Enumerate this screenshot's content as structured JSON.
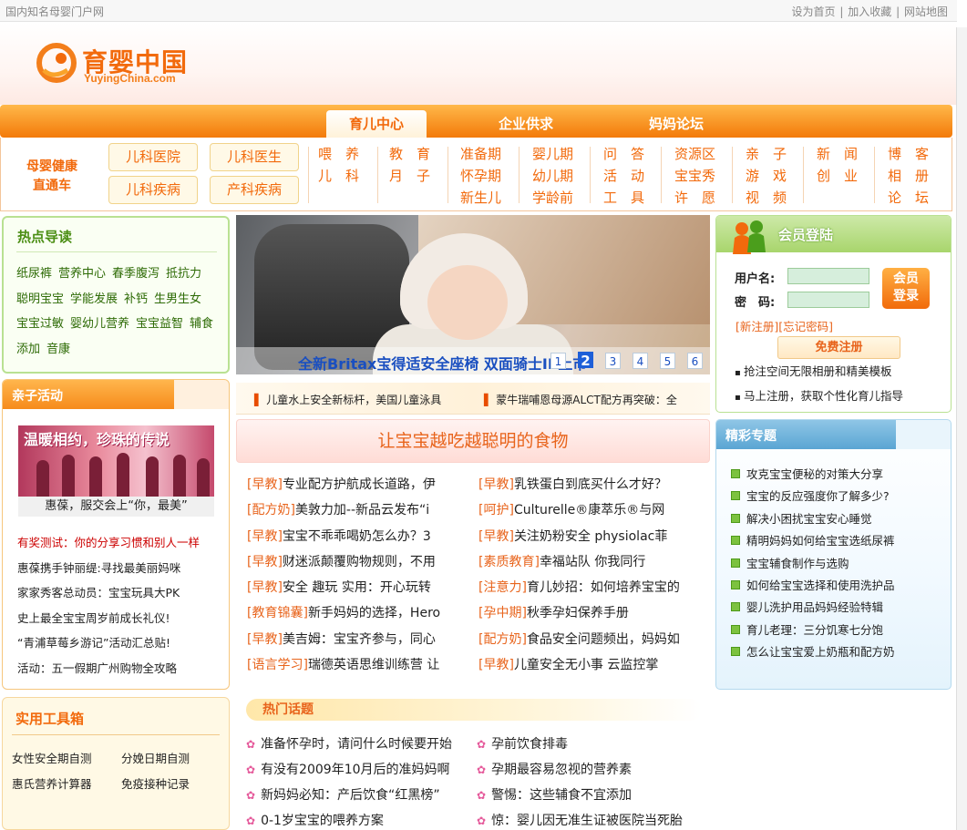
{
  "topbar": {
    "left_text": "国内知名母婴门户网",
    "links": [
      "设为首页",
      "加入收藏",
      "网站地图"
    ],
    "separator": "|"
  },
  "logo": {
    "name": "育婴中国",
    "sub": "YuyingChina.com"
  },
  "nav": {
    "tabs": [
      "育儿中心",
      "企业供求",
      "妈妈论坛"
    ]
  },
  "subnav": {
    "direct": [
      "母婴健康",
      "直通车"
    ],
    "buttons": [
      "儿科医院",
      "儿科医生",
      "儿科疾病",
      "产科疾病"
    ],
    "cols": [
      [
        "喂　养",
        "儿　科"
      ],
      [
        "教　育",
        "月　子"
      ],
      [
        "准备期",
        "怀孕期",
        "新生儿"
      ],
      [
        "婴儿期",
        "幼儿期",
        "学龄前"
      ],
      [
        "问　答",
        "活　动",
        "工　具"
      ],
      [
        "资源区",
        "宝宝秀",
        "许　愿"
      ],
      [
        "亲　子",
        "游　戏",
        "视　频"
      ],
      [
        "新　闻",
        "创　业"
      ],
      [
        "博　客",
        "相　册",
        "论　坛"
      ]
    ]
  },
  "hot": {
    "title": "热点导读",
    "tags": [
      "纸尿裤",
      "营养中心",
      "春季腹泻",
      "抵抗力",
      "聪明宝宝",
      "学能发展",
      "补钙",
      "生男生女",
      "宝宝过敏",
      "婴幼儿营养",
      "宝宝益智",
      "辅食",
      "添加",
      "音康"
    ]
  },
  "activity": {
    "title": "亲子活动",
    "photo_text": "温暖相约，珍珠的传说",
    "caption": "惠葆，服交会上“你，最美”",
    "items": [
      "有奖测试：你的分享习惯和别人一样",
      "惠葆携手钟丽缇:寻找最美丽妈咪",
      "家家秀客总动员：宝宝玩具大PK",
      "史上最全宝宝周岁前成长礼仪!",
      "“青浦草莓乡游记”活动汇总贴!",
      "活动：五一假期广州购物全攻略"
    ]
  },
  "tools": {
    "title": "实用工具箱",
    "items": [
      "女性安全期自测",
      "分娩日期自测",
      "惠氏营养计算器",
      "免疫接种记录"
    ]
  },
  "banner": {
    "caption": "全新Britax宝得适安全座椅 双面骑士II 上市",
    "pages": [
      "1",
      "2",
      "3",
      "4",
      "5",
      "6"
    ],
    "active": "2"
  },
  "ticker": [
    "儿童水上安全新标杆，美国儿童泳具",
    "蒙牛瑞哺恩母源ALCT配方再突破：全"
  ],
  "feature": {
    "title": "让宝宝越吃越聪明的食物"
  },
  "news_left": [
    {
      "cat": "[早教]",
      "text": "专业配方护航成长道路，伊"
    },
    {
      "cat": "[配方奶]",
      "text": "美敦力加--新品云发布“i"
    },
    {
      "cat": "[早教]",
      "text": "宝宝不乖乖喝奶怎么办？3"
    },
    {
      "cat": "[早教]",
      "text": "财迷派颠覆购物规则，不用"
    },
    {
      "cat": "[早教]",
      "text": "安全 趣玩 实用：开心玩转"
    },
    {
      "cat": "[教育锦囊]",
      "text": "新手妈妈的选择，Hero"
    },
    {
      "cat": "[早教]",
      "text": "美吉姆：宝宝齐参与，同心"
    },
    {
      "cat": "[语言学习]",
      "text": "瑞德英语思维训练营 让"
    }
  ],
  "news_right": [
    {
      "cat": "[早教]",
      "text": "乳铁蛋白到底买什么才好？"
    },
    {
      "cat": "[呵护]",
      "text": "Culturelle®康萃乐®与网"
    },
    {
      "cat": "[早教]",
      "text": "关注奶粉安全 physiolac菲"
    },
    {
      "cat": "[素质教育]",
      "text": "幸福站队 你我同行"
    },
    {
      "cat": "[注意力]",
      "text": "育儿妙招：如何培养宝宝的"
    },
    {
      "cat": "[孕中期]",
      "text": "秋季孕妇保养手册"
    },
    {
      "cat": "[配方奶]",
      "text": "食品安全问题频出，妈妈如"
    },
    {
      "cat": "[早教]",
      "text": "儿童安全无小事 云监控掌"
    }
  ],
  "hot_topics": {
    "title": "热门话题",
    "left": [
      "准备怀孕时，请问什么时候要开始",
      "有没有2009年10月后的准妈妈啊",
      "新妈妈必知：产后饮食“红黑榜”",
      "0-1岁宝宝的喂养方案"
    ],
    "right": [
      "孕前饮食排毒",
      "孕期最容易忽视的营养素",
      "警惕：这些辅食不宜添加",
      "惊：婴儿因无准生证被医院当死胎"
    ]
  },
  "login": {
    "title": "会员登陆",
    "user_label": "用户名:",
    "pass_label": "密　码:",
    "button": [
      "会员",
      "登录"
    ],
    "register": "[新注册]",
    "forgot": "[忘记密码]",
    "free_register": "免费注册",
    "benefits": [
      "抢注空间无限相册和精美模板",
      "马上注册，获取个性化育儿指导"
    ]
  },
  "special": {
    "title": "精彩专题",
    "items": [
      "攻克宝宝便秘的对策大分享",
      "宝宝的反应强度你了解多少?",
      "解决小困扰宝宝安心睡觉",
      "精明妈妈如何给宝宝选纸尿裤",
      "宝宝辅食制作与选购",
      "如何给宝宝选择和使用洗护品",
      "婴儿洗护用品妈妈经验特辑",
      "育儿老理：三分饥寒七分饱",
      "怎么让宝宝爱上奶瓶和配方奶"
    ]
  },
  "colors": {
    "orange": "#f26a0c",
    "green": "#4b8e14",
    "blue": "#5aa5d3"
  }
}
